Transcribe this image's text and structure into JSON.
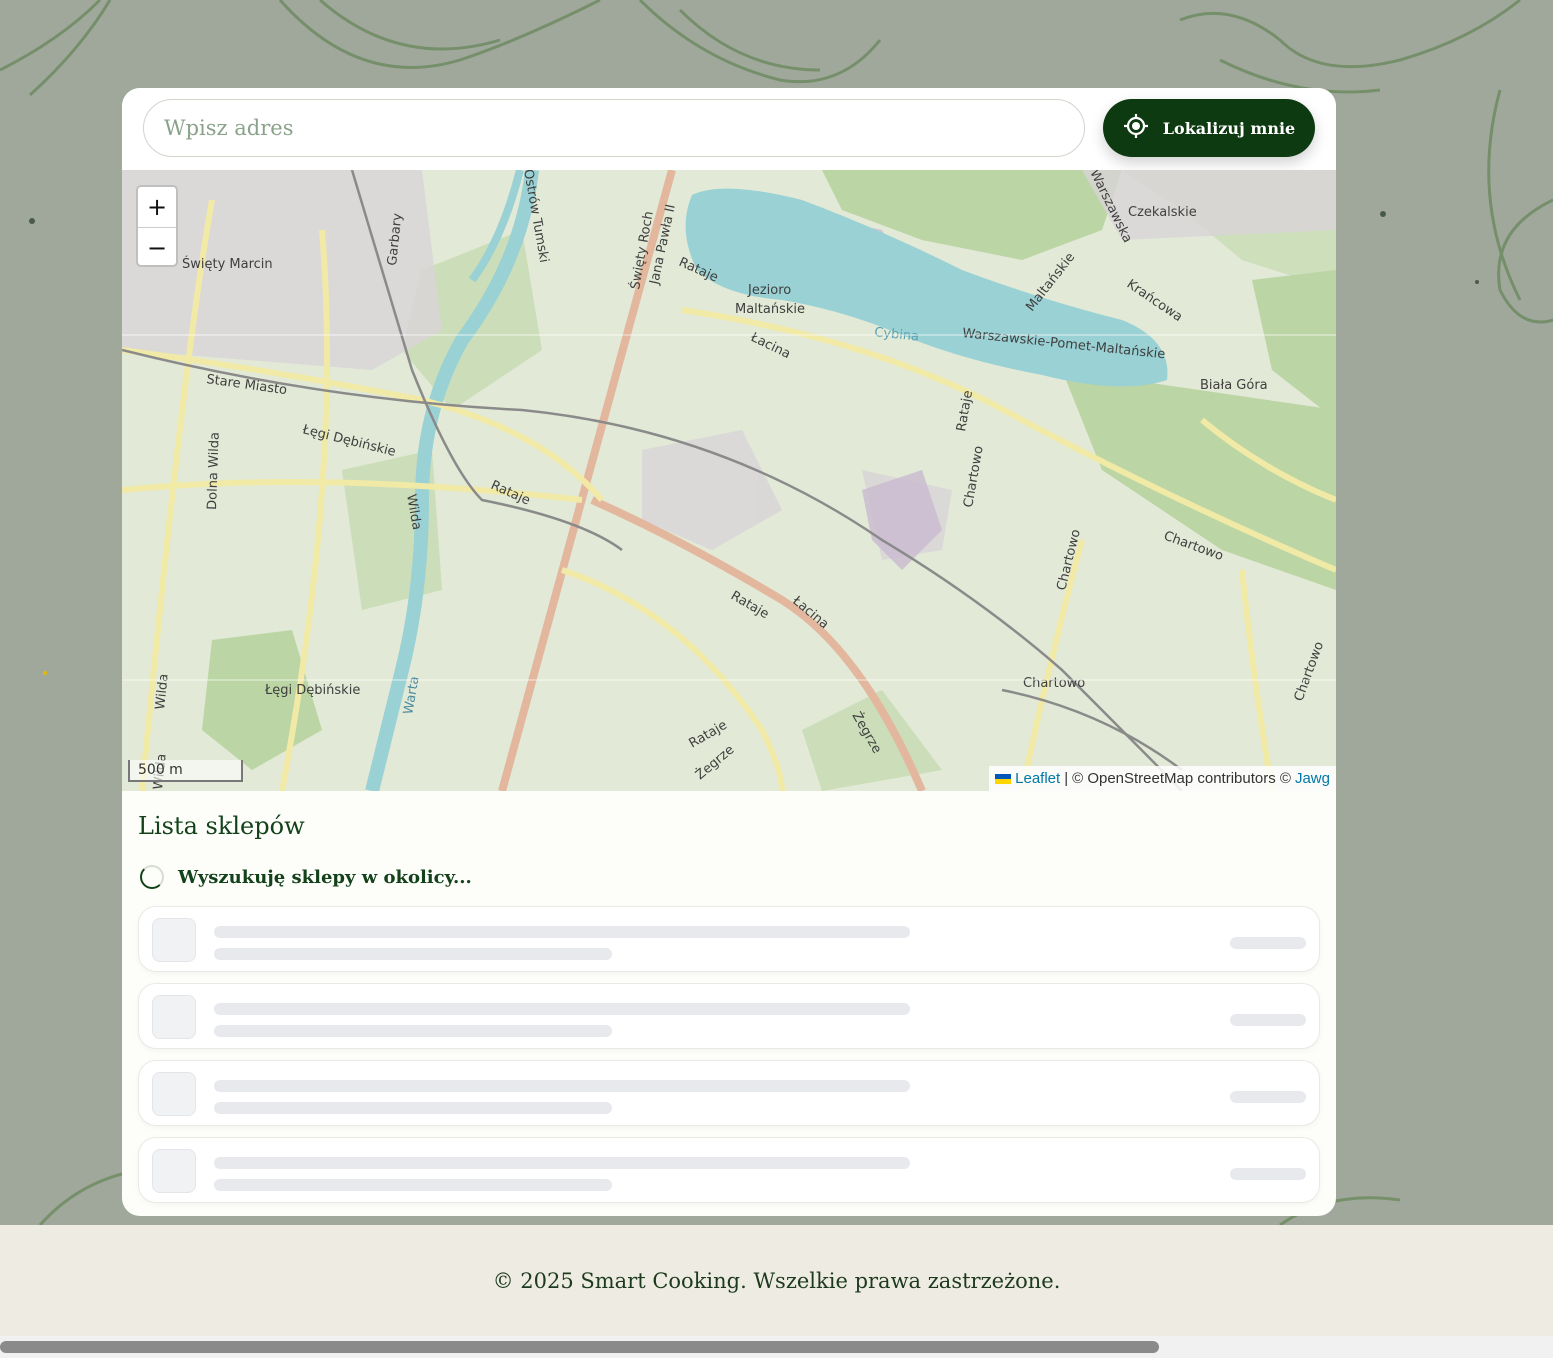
{
  "search": {
    "placeholder": "Wpisz adres",
    "value": ""
  },
  "locate_button": {
    "label": "Lokalizuj mnie",
    "icon": "crosshair-icon"
  },
  "map": {
    "zoom_in": "+",
    "zoom_out": "−",
    "scale": "500 m",
    "labels": {
      "swiety_marcin": "Święty Marcin",
      "stare_miasto": "Stare Miasto",
      "legi_debinskie_1": "Łęgi Dębińskie",
      "legi_debinskie_2": "Łęgi Dębińskie",
      "dolna_wilda": "Dolna Wilda",
      "wilda_1": "Wilda",
      "wilda_2": "Wilda",
      "warta": "Warta",
      "rataje_1": "Rataje",
      "rataje_2": "Rataje",
      "rataje_3": "Rataje",
      "rataje_4": "Rataje",
      "rataje_5": "Rataje",
      "garbary": "Garbary",
      "swiety_roch": "Święty Roch",
      "jana_pawla": "Jana Pawła II",
      "jezioro_1": "Jezioro",
      "jezioro_2": "Maltańskie",
      "cybina": "Cybina",
      "lacina_1": "Łacina",
      "lacina_2": "Łacina",
      "warszawskie": "Warszawskie-Pomet-Maltańskie",
      "czekalskie": "Czekalskie",
      "warszawska": "Warszawska",
      "maltanskie": "Maltańskie",
      "krancowa": "Krańcowa",
      "biala_gora": "Biała Góra",
      "chartowo_1": "Chartowo",
      "chartowo_2": "Chartowo",
      "chartowo_3": "Chartowo",
      "chartowo_4": "Chartowo",
      "chartowo_5": "Chartowo",
      "zegrze_1": "Żegrze",
      "zegrze_2": "Żegrze",
      "tumski": "Ostrów Tumski",
      "wilda_3": "Wilda"
    },
    "attribution": {
      "leaflet": "Leaflet",
      "sep": "|",
      "osm": "© OpenStreetMap contributors ©",
      "jawg": "Jawg"
    }
  },
  "list": {
    "title": "Lista sklepów",
    "loading_text": "Wyszukuję sklepy w okolicy...",
    "placeholders": 4
  },
  "footer": {
    "text": "© 2025 Smart Cooking. Wszelkie prawa zastrzeżone."
  },
  "colors": {
    "primary": "#0e3a12",
    "water": "#9ad1d4",
    "background": "#a0a89c"
  }
}
